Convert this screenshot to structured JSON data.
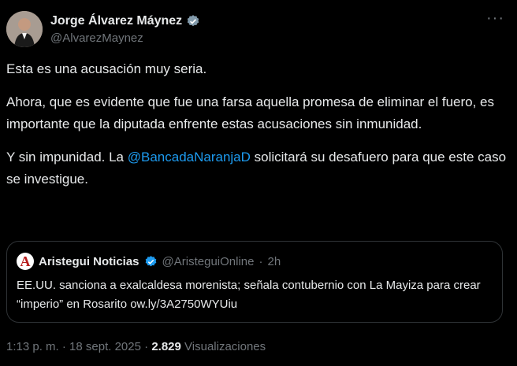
{
  "author": {
    "name": "Jorge Álvarez Máynez",
    "handle": "@AlvarezMaynez",
    "verified_icon": "verified-badge-icon"
  },
  "tweet": {
    "p1": "Esta es una acusación muy seria.",
    "p2": "Ahora, que es evidente que fue una farsa aquella promesa de eliminar el fuero, es importante que la diputada enfrente estas acusaciones sin inmunidad.",
    "p3_before": "Y sin impunidad. La ",
    "p3_mention": "@BancadaNaranjaD",
    "p3_after": " solicitará su desafuero para que este caso se investigue."
  },
  "quote": {
    "name": "Aristegui Noticias",
    "handle": "@AristeguiOnline",
    "separator": "·",
    "time": "2h",
    "text": "EE.UU. sanciona a exalcaldesa morenista; señala contubernio con La Mayiza para crear “imperio” en Rosarito ow.ly/3A2750WYUiu",
    "logo_letter": "A"
  },
  "footer": {
    "time": "1:13 p. m.",
    "dot1": "·",
    "date": "18 sept. 2025",
    "dot2": "·",
    "views_count": "2.829",
    "views_label": "Visualizaciones"
  },
  "colors": {
    "accent": "#1d9bf0",
    "muted": "#71767b",
    "background": "#000000"
  }
}
